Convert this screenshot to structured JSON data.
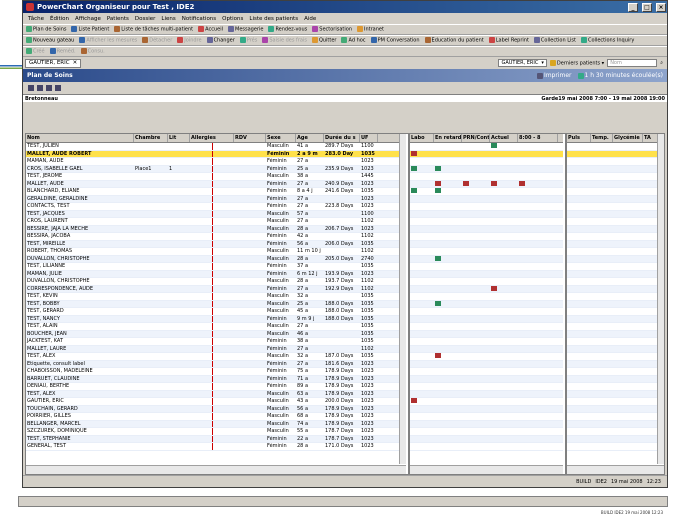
{
  "title": "PowerChart Organiseur pour Test , IDE2",
  "menu": [
    "Tâche",
    "Édition",
    "Affichage",
    "Patients",
    "Dossier",
    "Liens",
    "Notifications",
    "Options",
    "Liste des patients",
    "Aide"
  ],
  "toolbar1": [
    "Plan de Soins",
    "Liste Patient",
    "Liste de tâches multi-patient",
    "Accueil",
    "Messagerie",
    "Rendez-vous",
    "Sectorisation",
    "Intranet"
  ],
  "toolbar2": [
    "Nouveau gateau",
    "Afficher les mesures",
    "Détacher",
    "Joindre",
    "Changer",
    "Prés",
    "Saisie des frais",
    "Quitter",
    "Ad hoc",
    "PM Conversation",
    "Education du patient",
    "Label Reprint",
    "Collection List",
    "Collections Inquiry"
  ],
  "toolbar3": [
    "Créé",
    "Reméd.",
    "Consu."
  ],
  "patient_tab": "GAUTIER, ERIC",
  "patient_combo": "GAUTIER, ERIC",
  "recent_patients": "Derniers patients",
  "search_placeholder": "Nom",
  "section_title": "Plan de Soins",
  "print_label": "Imprimer",
  "refresh_label": "1 h 30 minutes écoulée(s)",
  "unit": "Bretonneau",
  "guard": "Garde19 mai 2008 7:00  -  19 mai 2008 19:00",
  "columns": [
    "Nom",
    "Chambre",
    "Lit",
    "Allergies",
    "RDV",
    "Sexe",
    "Age",
    "Durée du s",
    "UF"
  ],
  "mid_columns": [
    "Labo",
    "En retard",
    "PRN/Conti",
    "Actuel",
    "8:00 - 8"
  ],
  "right_columns": [
    "Puls",
    "Temp.",
    "Glycémie",
    "TA"
  ],
  "rows": [
    [
      "TEST, JULIEN",
      "",
      "",
      "",
      "",
      "Masculin",
      "41 a",
      "289.7 Days",
      "1100"
    ],
    [
      "MALLET, AUDE ROBERT",
      "",
      "",
      "",
      "",
      "Féminin",
      "2 a 9 m",
      "283.0 Day",
      "1035"
    ],
    [
      "MAMAN, AUDE",
      "",
      "",
      "",
      "",
      "Féminin",
      "27 a",
      "",
      "1023"
    ],
    [
      "CROS, ISABELLE GAEL",
      "Place1",
      "1",
      "",
      "",
      "Féminin",
      "25 a",
      "235.9 Days",
      "1023"
    ],
    [
      "TEST, JEROME",
      "",
      "",
      "",
      "",
      "Masculin",
      "38 a",
      "",
      "1445"
    ],
    [
      "MALLET, AUDE",
      "",
      "",
      "",
      "",
      "Féminin",
      "27 a",
      "240.9 Days",
      "1023"
    ],
    [
      "BLANCHARD, ELIANE",
      "",
      "",
      "",
      "",
      "Féminin",
      "8 a 4 j",
      "241.6 Days",
      "1035"
    ],
    [
      "GERALDINE, GERALDINE",
      "",
      "",
      "",
      "",
      "Féminin",
      "27 a",
      "",
      "1023"
    ],
    [
      "CONTACTS, TEST",
      "",
      "",
      "",
      "",
      "Féminin",
      "27 a",
      "223.8 Days",
      "1023"
    ],
    [
      "TEST, JACQUES",
      "",
      "",
      "",
      "",
      "Masculin",
      "57 a",
      "",
      "1100"
    ],
    [
      "CROS, LAURENT",
      "",
      "",
      "",
      "",
      "Masculin",
      "27 a",
      "",
      "1102"
    ],
    [
      "BESSIRE, JAJA LA MECHE",
      "",
      "",
      "",
      "",
      "Masculin",
      "28 a",
      "206.7 Days",
      "1023"
    ],
    [
      "BESSIRA, JACOBA",
      "",
      "",
      "",
      "",
      "Féminin",
      "42 a",
      "",
      "1102"
    ],
    [
      "TEST, MIREILLE",
      "",
      "",
      "",
      "",
      "Féminin",
      "56 a",
      "206.0 Days",
      "1035"
    ],
    [
      "ROBERT, THOMAS",
      "",
      "",
      "",
      "",
      "Masculin",
      "11 m 10 j",
      "",
      "1102"
    ],
    [
      "DUVALLON, CHRISTOPHE",
      "",
      "",
      "",
      "",
      "Masculin",
      "28 a",
      "205.0 Days",
      "2740"
    ],
    [
      "TEST, LILIANNE",
      "",
      "",
      "",
      "",
      "Féminin",
      "37 a",
      "",
      "1035"
    ],
    [
      "MAMAN, JULIE",
      "",
      "",
      "",
      "",
      "Féminin",
      "6 m 12 j",
      "193.9 Days",
      "1023"
    ],
    [
      "DUVALLON, CHRISTOPHE",
      "",
      "",
      "",
      "",
      "Masculin",
      "28 a",
      "193.7 Days",
      "1102"
    ],
    [
      "CORRESPONDENCE, AUDE",
      "",
      "",
      "",
      "",
      "Féminin",
      "27 a",
      "192.9 Days",
      "1102"
    ],
    [
      "TEST, KEVIN",
      "",
      "",
      "",
      "",
      "Masculin",
      "32 a",
      "",
      "1035"
    ],
    [
      "TEST, BOBBY",
      "",
      "",
      "",
      "",
      "Masculin",
      "25 a",
      "188.0 Days",
      "1035"
    ],
    [
      "TEST, GERARD",
      "",
      "",
      "",
      "",
      "Masculin",
      "45 a",
      "188.0 Days",
      "1035"
    ],
    [
      "TEST, NANCY",
      "",
      "",
      "",
      "",
      "Féminin",
      "9 m 9 j",
      "188.0 Days",
      "1035"
    ],
    [
      "TEST, ALAIN",
      "",
      "",
      "",
      "",
      "Masculin",
      "27 a",
      "",
      "1035"
    ],
    [
      "BOUCHER, JEAN",
      "",
      "",
      "",
      "",
      "Masculin",
      "46 a",
      "",
      "1035"
    ],
    [
      "JACKTEST, KAT",
      "",
      "",
      "",
      "",
      "Féminin",
      "38 a",
      "",
      "1035"
    ],
    [
      "MALLET, LAURE",
      "",
      "",
      "",
      "",
      "Féminin",
      "27 a",
      "",
      "1102"
    ],
    [
      "TEST, ALEX",
      "",
      "",
      "",
      "",
      "Masculin",
      "32 a",
      "187.0 Days",
      "1035"
    ],
    [
      "Etiquette, consult label",
      "",
      "",
      "",
      "",
      "Féminin",
      "27 a",
      "181.6 Days",
      "1023"
    ],
    [
      "CHABOISSON, MADELEINE",
      "",
      "",
      "",
      "",
      "Féminin",
      "75 a",
      "178.9 Days",
      "1023"
    ],
    [
      "BARRUET, CLAUDINE",
      "",
      "",
      "",
      "",
      "Féminin",
      "71 a",
      "178.9 Days",
      "1023"
    ],
    [
      "DENIAU, BERTHE",
      "",
      "",
      "",
      "",
      "Féminin",
      "89 a",
      "178.9 Days",
      "1023"
    ],
    [
      "TEST, ALEX",
      "",
      "",
      "",
      "",
      "Masculin",
      "63 a",
      "178.9 Days",
      "1023"
    ],
    [
      "GAUTIER, ERIC",
      "",
      "",
      "",
      "",
      "Masculin",
      "43 a",
      "200.0 Days",
      "1023"
    ],
    [
      "TOUCHAIN, GERARD",
      "",
      "",
      "",
      "",
      "Masculin",
      "56 a",
      "178.9 Days",
      "1023"
    ],
    [
      "POIRRIER, GILLES",
      "",
      "",
      "",
      "",
      "Masculin",
      "68 a",
      "178.9 Days",
      "1023"
    ],
    [
      "BELLANGER, MARCEL",
      "",
      "",
      "",
      "",
      "Masculin",
      "74 a",
      "178.9 Days",
      "1023"
    ],
    [
      "SZCZUREK, DOMINIQUE",
      "",
      "",
      "",
      "",
      "Masculin",
      "55 a",
      "178.7 Days",
      "1023"
    ],
    [
      "TEST, STEPHANIE",
      "",
      "",
      "",
      "",
      "Féminin",
      "22 a",
      "178.7 Days",
      "1023"
    ],
    [
      "GENERAL, TEST",
      "",
      "",
      "",
      "",
      "Féminin",
      "28 a",
      "171.0 Days",
      "1023"
    ]
  ],
  "status_build": "BUILD",
  "status_user": "IDE2",
  "status_date": "19 mai 2008",
  "status_time": "12:23",
  "footer": "BUILD  IDE2  19 mai 2008  12:23"
}
